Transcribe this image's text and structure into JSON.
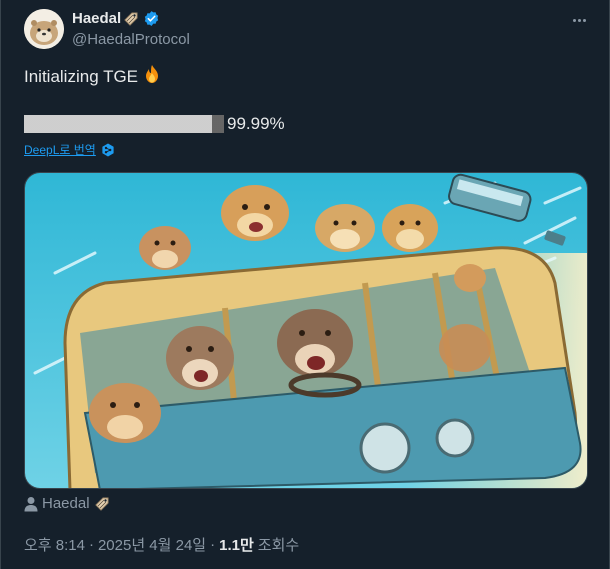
{
  "account": {
    "display_name": "Haedal",
    "handle": "@HaedalProtocol"
  },
  "tweet": {
    "text": "Initializing TGE",
    "progress_percent": 99.99,
    "progress_label": "99.99%",
    "translate_label": "DeepL로 번역"
  },
  "media": {
    "alt_author": "Haedal"
  },
  "meta": {
    "time": "오후 8:14",
    "sep1": "·",
    "date": "2025년 4월 24일",
    "sep2": "·",
    "views_count": "1.1만",
    "views_label": "조회수"
  },
  "colors": {
    "background": "#15202b",
    "accent": "#1d9bf0",
    "muted": "#8b98a5"
  },
  "icons": [
    "verified-badge-icon",
    "tag-icon",
    "more-icon",
    "fire-icon",
    "deepl-icon",
    "person-icon"
  ]
}
